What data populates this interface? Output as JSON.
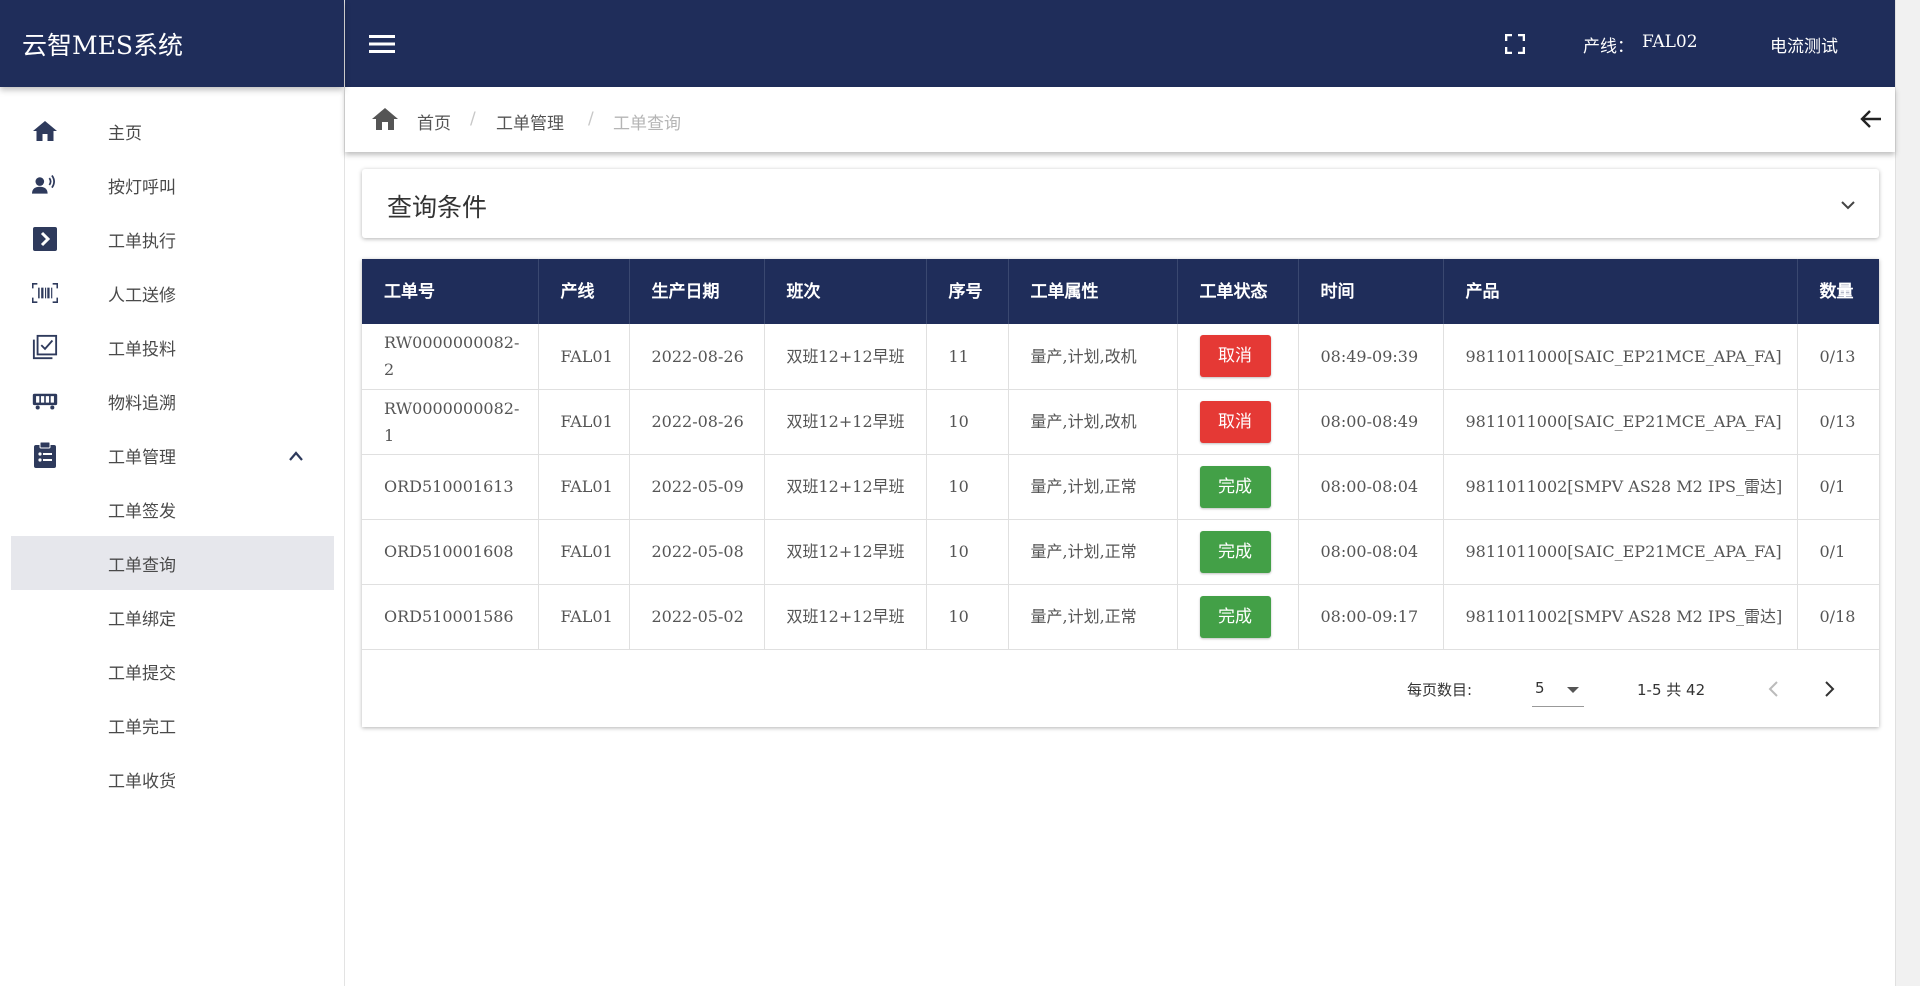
{
  "app": {
    "title": "云智MES系统"
  },
  "sidebar": {
    "items": [
      {
        "label": "主页",
        "icon": "home-icon"
      },
      {
        "label": "按灯呼叫",
        "icon": "voice-call-icon"
      },
      {
        "label": "工单执行",
        "icon": "execute-icon"
      },
      {
        "label": "人工送修",
        "icon": "barcode-scan-icon"
      },
      {
        "label": "工单投料",
        "icon": "checklist-icon"
      },
      {
        "label": "物料追溯",
        "icon": "trace-icon"
      },
      {
        "label": "工单管理",
        "icon": "clipboard-icon"
      }
    ],
    "sub_items": [
      {
        "label": "工单签发"
      },
      {
        "label": "工单查询"
      },
      {
        "label": "工单绑定"
      },
      {
        "label": "工单提交"
      },
      {
        "label": "工单完工"
      },
      {
        "label": "工单收货"
      }
    ]
  },
  "topbar": {
    "line_label": "产线：",
    "line_value": "FAL02",
    "station": "电流测试"
  },
  "breadcrumb": {
    "home": "首页",
    "level1": "工单管理",
    "level2": "工单查询",
    "separator": "/"
  },
  "query": {
    "title": "查询条件"
  },
  "table": {
    "headers": [
      "工单号",
      "产线",
      "生产日期",
      "班次",
      "序号",
      "工单属性",
      "工单状态",
      "时间",
      "产品",
      "数量"
    ],
    "rows": [
      {
        "order": "RW0000000082-2",
        "line": "FAL01",
        "date": "2022-08-26",
        "shift": "双班12+12早班",
        "seq": "11",
        "attr": "量产,计划,改机",
        "status": "取消",
        "time": "08:49-09:39",
        "product": "9811011000[SAIC_EP21MCE_APA_FA]",
        "qty": "0/13"
      },
      {
        "order": "RW0000000082-1",
        "line": "FAL01",
        "date": "2022-08-26",
        "shift": "双班12+12早班",
        "seq": "10",
        "attr": "量产,计划,改机",
        "status": "取消",
        "time": "08:00-08:49",
        "product": "9811011000[SAIC_EP21MCE_APA_FA]",
        "qty": "0/13"
      },
      {
        "order": "ORD510001613",
        "line": "FAL01",
        "date": "2022-05-09",
        "shift": "双班12+12早班",
        "seq": "10",
        "attr": "量产,计划,正常",
        "status": "完成",
        "time": "08:00-08:04",
        "product": "9811011002[SMPV AS28 M2 IPS_雷达]",
        "qty": "0/1"
      },
      {
        "order": "ORD510001608",
        "line": "FAL01",
        "date": "2022-05-08",
        "shift": "双班12+12早班",
        "seq": "10",
        "attr": "量产,计划,正常",
        "status": "完成",
        "time": "08:00-08:04",
        "product": "9811011000[SAIC_EP21MCE_APA_FA]",
        "qty": "0/1"
      },
      {
        "order": "ORD510001586",
        "line": "FAL01",
        "date": "2022-05-02",
        "shift": "双班12+12早班",
        "seq": "10",
        "attr": "量产,计划,正常",
        "status": "完成",
        "time": "08:00-09:17",
        "product": "9811011002[SMPV AS28 M2 IPS_雷达]",
        "qty": "0/18"
      }
    ]
  },
  "pager": {
    "rows_label": "每页数目:",
    "page_size": "5",
    "range": "1-5 共 42"
  },
  "colors": {
    "navy": "#1f2d5a",
    "cancel": "#e53935",
    "done": "#43a047",
    "active_bg": "#e6e7ec"
  }
}
